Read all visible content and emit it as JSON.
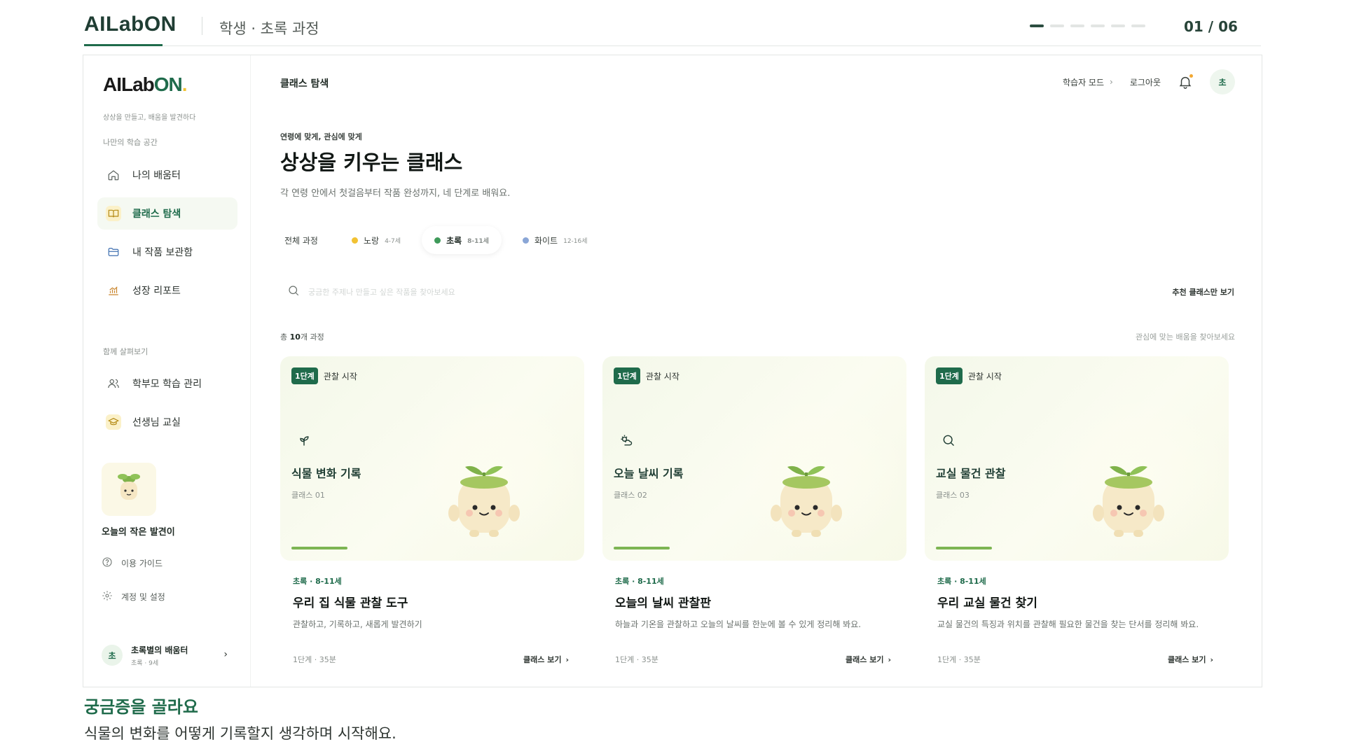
{
  "deck": {
    "brand": "AILabON",
    "subtitle": "학생 · 초록 과정",
    "page_indicator": {
      "current": 1,
      "total": 6
    },
    "counter": "01 / 06"
  },
  "sidebar": {
    "logo_main": "AILab",
    "logo_accent": "ON",
    "tagline": "상상을 만들고, 배움을 발견하다",
    "section_personal": "나만의 학습 공간",
    "items": [
      {
        "label": "나의 배움터",
        "icon": "home-icon",
        "active": false
      },
      {
        "label": "클래스 탐색",
        "icon": "book-icon",
        "active": true
      },
      {
        "label": "내 작품 보관함",
        "icon": "folder-icon",
        "active": false
      },
      {
        "label": "성장 리포트",
        "icon": "chart-icon",
        "active": false
      }
    ],
    "section_shared": "함께 살펴보기",
    "shared_items": [
      {
        "label": "학부모 학습 관리",
        "icon": "users-icon"
      },
      {
        "label": "선생님 교실",
        "icon": "graduation-cap-icon"
      }
    ],
    "discovery_label": "오늘의 작은 발견이",
    "utils": [
      {
        "label": "이용 가이드",
        "icon": "help-icon"
      },
      {
        "label": "계정 및 설정",
        "icon": "gear-icon"
      }
    ],
    "profile": {
      "avatar": "초",
      "name": "초록별의 배움터",
      "meta": "초록 · 9세"
    }
  },
  "topbar": {
    "title": "클래스 탐색",
    "mode_link": "학습자 모드",
    "logout": "로그아웃",
    "avatar": "초"
  },
  "hero": {
    "eyebrow": "연령에 맞게, 관심에 맞게",
    "title": "상상을 키우는 클래스",
    "description": "각 연령 안에서 첫걸음부터 작품 완성까지, 네 단계로 배워요."
  },
  "filters": [
    {
      "label": "전체 과정",
      "age": "",
      "color": "",
      "active": false
    },
    {
      "label": "노랑",
      "age": "4-7세",
      "color": "#f2c233",
      "active": false
    },
    {
      "label": "초록",
      "age": "8-11세",
      "color": "#3f9a5a",
      "active": true
    },
    {
      "label": "화이트",
      "age": "12-16세",
      "color": "#8aa6d6",
      "active": false
    }
  ],
  "search": {
    "placeholder": "궁금한 주제나 만들고 싶은 작품을 찾아보세요",
    "recommend_toggle": "추천 클래스만 보기"
  },
  "list": {
    "count_prefix": "총 ",
    "count": "10",
    "count_suffix": "개 과정",
    "hint": "관심에 맞는 배움을 찾아보세요"
  },
  "cards": [
    {
      "stage": "1단계",
      "stage_text": "관찰 시작",
      "icon": "sprout-icon",
      "name": "식물 변화 기록",
      "number": "클래스 01",
      "progress": 0.2,
      "meta": "초록 · 8-11세",
      "title": "우리 집 식물 관찰 도구",
      "description": "관찰하고, 기록하고, 새롭게 발견하기",
      "duration": "1단계 · 35분",
      "link": "클래스 보기"
    },
    {
      "stage": "1단계",
      "stage_text": "관찰 시작",
      "icon": "weather-icon",
      "name": "오늘 날씨 기록",
      "number": "클래스 02",
      "progress": 0.2,
      "meta": "초록 · 8-11세",
      "title": "오늘의 날씨 관찰판",
      "description": "하늘과 기온을 관찰하고 오늘의 날씨를 한눈에 볼 수 있게 정리해 봐요.",
      "duration": "1단계 · 35분",
      "link": "클래스 보기"
    },
    {
      "stage": "1단계",
      "stage_text": "관찰 시작",
      "icon": "magnifier-icon",
      "name": "교실 물건 관찰",
      "number": "클래스 03",
      "progress": 0.2,
      "meta": "초록 · 8-11세",
      "title": "우리 교실 물건 찾기",
      "description": "교실 물건의 특징과 위치를 관찰해 필요한 물건을 찾는 단서를 정리해 봐요.",
      "duration": "1단계 · 35분",
      "link": "클래스 보기"
    }
  ],
  "caption": {
    "title": "궁금증을 골라요",
    "body": "식물의 변화를 어떻게 기록할지 생각하며 시작해요."
  },
  "colors": {
    "brand_green": "#1f6b4b",
    "accent_yellow": "#f2c233",
    "progress_green": "#7db553"
  }
}
